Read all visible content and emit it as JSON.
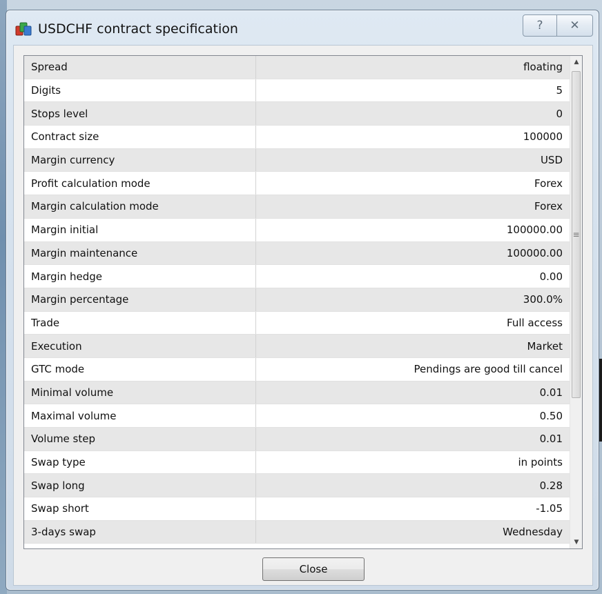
{
  "window": {
    "title": "USDCHF contract specification",
    "help_glyph": "?",
    "close_glyph": "✕"
  },
  "specs": [
    {
      "name": "Spread",
      "value": "floating"
    },
    {
      "name": "Digits",
      "value": "5"
    },
    {
      "name": "Stops level",
      "value": "0"
    },
    {
      "name": "Contract size",
      "value": "100000"
    },
    {
      "name": "Margin currency",
      "value": "USD"
    },
    {
      "name": "Profit calculation mode",
      "value": "Forex"
    },
    {
      "name": "Margin calculation mode",
      "value": "Forex"
    },
    {
      "name": "Margin initial",
      "value": "100000.00"
    },
    {
      "name": "Margin maintenance",
      "value": "100000.00"
    },
    {
      "name": "Margin hedge",
      "value": "0.00"
    },
    {
      "name": "Margin percentage",
      "value": "300.0%"
    },
    {
      "name": "Trade",
      "value": "Full access"
    },
    {
      "name": "Execution",
      "value": "Market"
    },
    {
      "name": "GTC mode",
      "value": "Pendings are good till cancel"
    },
    {
      "name": "Minimal volume",
      "value": "0.01"
    },
    {
      "name": "Maximal volume",
      "value": "0.50"
    },
    {
      "name": "Volume step",
      "value": "0.01"
    },
    {
      "name": "Swap type",
      "value": "in points"
    },
    {
      "name": "Swap long",
      "value": "0.28"
    },
    {
      "name": "Swap short",
      "value": "-1.05"
    },
    {
      "name": "3-days swap",
      "value": "Wednesday"
    }
  ],
  "buttons": {
    "close_label": "Close"
  },
  "icons": {
    "app": "app-icon",
    "help": "help-icon",
    "close": "close-icon",
    "scroll_up": "chevron-up-icon",
    "scroll_down": "chevron-down-icon",
    "grip": "scroll-grip-icon"
  }
}
